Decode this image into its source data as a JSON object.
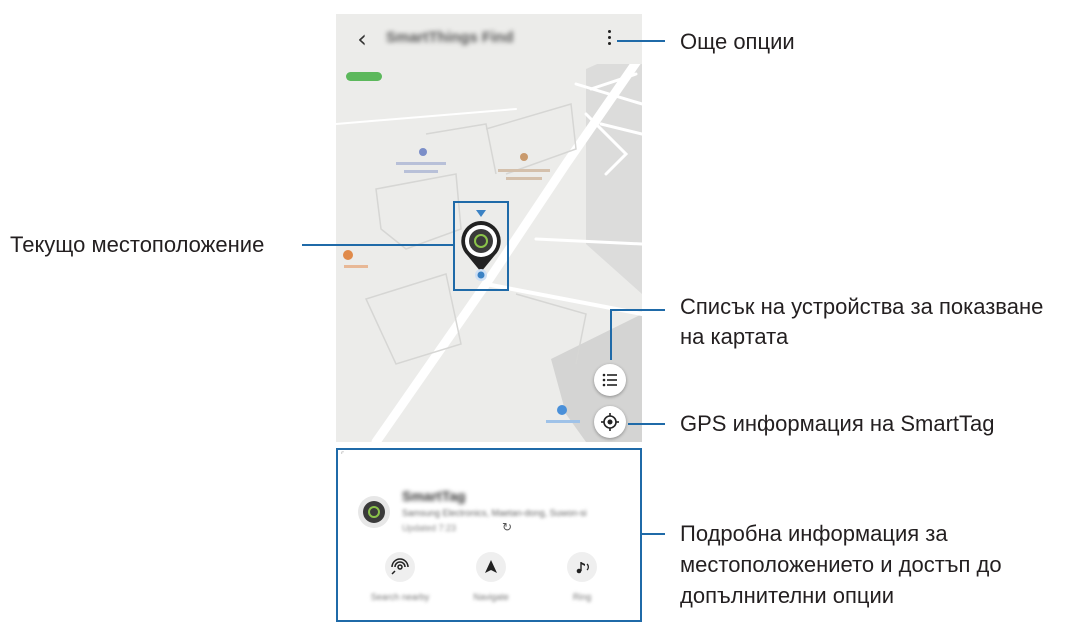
{
  "app": {
    "title": "SmartThings Find",
    "back_icon": "back-arrow-icon",
    "more_icon": "more-options-icon"
  },
  "map": {
    "places": [
      {
        "name": "Place 1",
        "icon": "building-icon",
        "color": "#7b8ec8"
      },
      {
        "name": "Place 2",
        "icon": "person-pin-icon",
        "color": "#c99a6d"
      },
      {
        "name": "Restaurant",
        "icon": "restaurant-icon",
        "color": "#e08a4a"
      },
      {
        "name": "Store",
        "icon": "shop-icon",
        "color": "#4a90d9"
      }
    ],
    "status_chip_color": "#5cb85c"
  },
  "device": {
    "name": "SmartTag",
    "address": "Samsung Electronics, Maetan-dong, Suwon-si",
    "time": "Updated 7:23",
    "marker_color": "#3a3a3a",
    "ring_color": "#8bc34a"
  },
  "actions": [
    {
      "label": "Search nearby",
      "icon": "signal-search-icon"
    },
    {
      "label": "Navigate",
      "icon": "navigate-arrow-icon"
    },
    {
      "label": "Ring",
      "icon": "music-note-icon"
    }
  ],
  "buttons": {
    "list_icon": "list-icon",
    "gps_icon": "gps-target-icon"
  },
  "callouts": {
    "more_options": "Още опции",
    "current_location": "Текущо местоположение",
    "device_list_line1": "Списък на устройства за показване",
    "device_list_line2": "на картата",
    "gps_info": "GPS информация на SmartTag",
    "details_line1": "Подробна информация за",
    "details_line2": "местоположението и достъп до",
    "details_line3": "допълнителни опции"
  },
  "colors": {
    "accent": "#1f6aa8",
    "text": "#231f20",
    "map_bg": "#ececea"
  }
}
